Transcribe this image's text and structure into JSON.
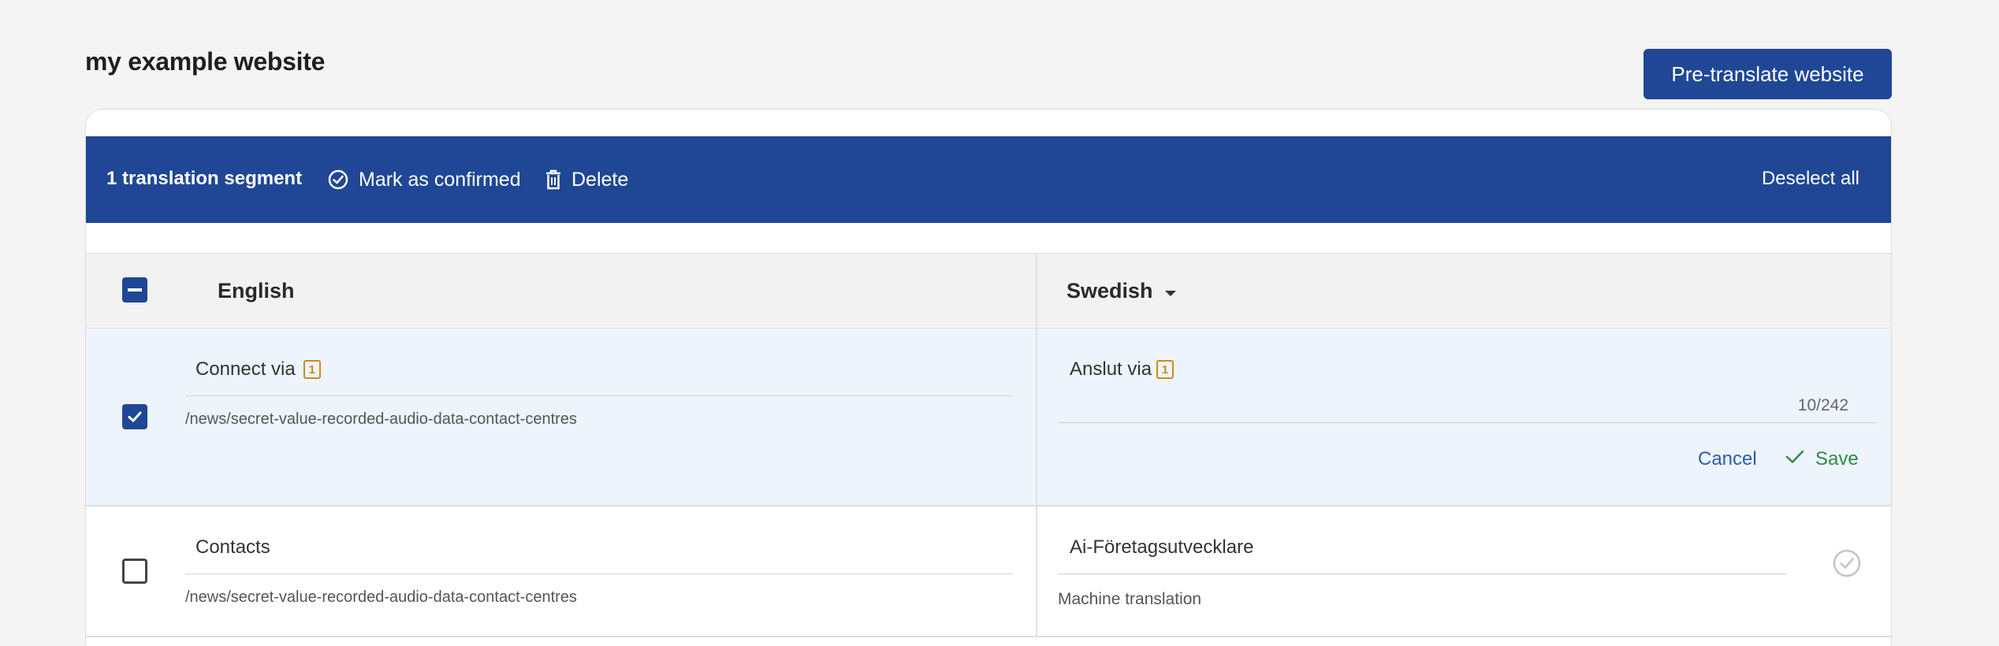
{
  "page": {
    "title": "my example website",
    "pretranslate_label": "Pre-translate website"
  },
  "action_bar": {
    "selection_count": "1 translation segment",
    "mark_confirmed_label": "Mark as confirmed",
    "delete_label": "Delete",
    "deselect_label": "Deselect all"
  },
  "table": {
    "source_language": "English",
    "target_language": "Swedish",
    "rows": [
      {
        "selected": true,
        "source": "Connect via",
        "source_tag": "1",
        "path": "/news/secret-value-recorded-audio-data-contact-centres",
        "target": "Anslut via",
        "target_tag": "1",
        "char_count": "10/242",
        "cancel_label": "Cancel",
        "save_label": "Save"
      },
      {
        "selected": false,
        "source": "Contacts",
        "path": "/news/secret-value-recorded-audio-data-contact-centres",
        "target": "Ai-Företagsutvecklare",
        "status": "Machine translation"
      }
    ]
  },
  "colors": {
    "primary": "#1f4796",
    "selected_row": "#edf4fc",
    "tag": "#d08a1a",
    "save": "#2e8a48",
    "link": "#2b5cae"
  }
}
